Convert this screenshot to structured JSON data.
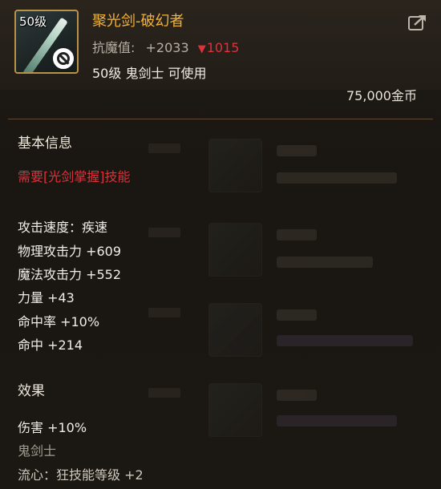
{
  "item": {
    "level_badge": "50级",
    "name": "聚光剑-破幻者",
    "anti_magic_label": "抗魔值:",
    "anti_magic_value": "+2033",
    "anti_magic_diff": "1015",
    "usage": "50级 鬼剑士 可使用",
    "price": "75,000金币"
  },
  "basic_info": {
    "title": "基本信息",
    "requirement": "需要[光剑掌握]技能",
    "stats": [
      "攻击速度：疾速",
      "物理攻击力 +609",
      "魔法攻击力 +552",
      "力量 +43",
      "命中率 +10%",
      "命中 +214"
    ]
  },
  "effects": {
    "title": "效果",
    "lines": [
      "伤害 +10%",
      "鬼剑士",
      "流心：狂技能等级 +2"
    ]
  },
  "colors": {
    "name": "#f2b33a",
    "requirement": "#e0303a",
    "down_arrow": "#e0303a",
    "frame": "#b9924a"
  },
  "icons": [
    "sword-item-icon",
    "no-use-icon",
    "share-icon",
    "down-arrow-icon"
  ]
}
